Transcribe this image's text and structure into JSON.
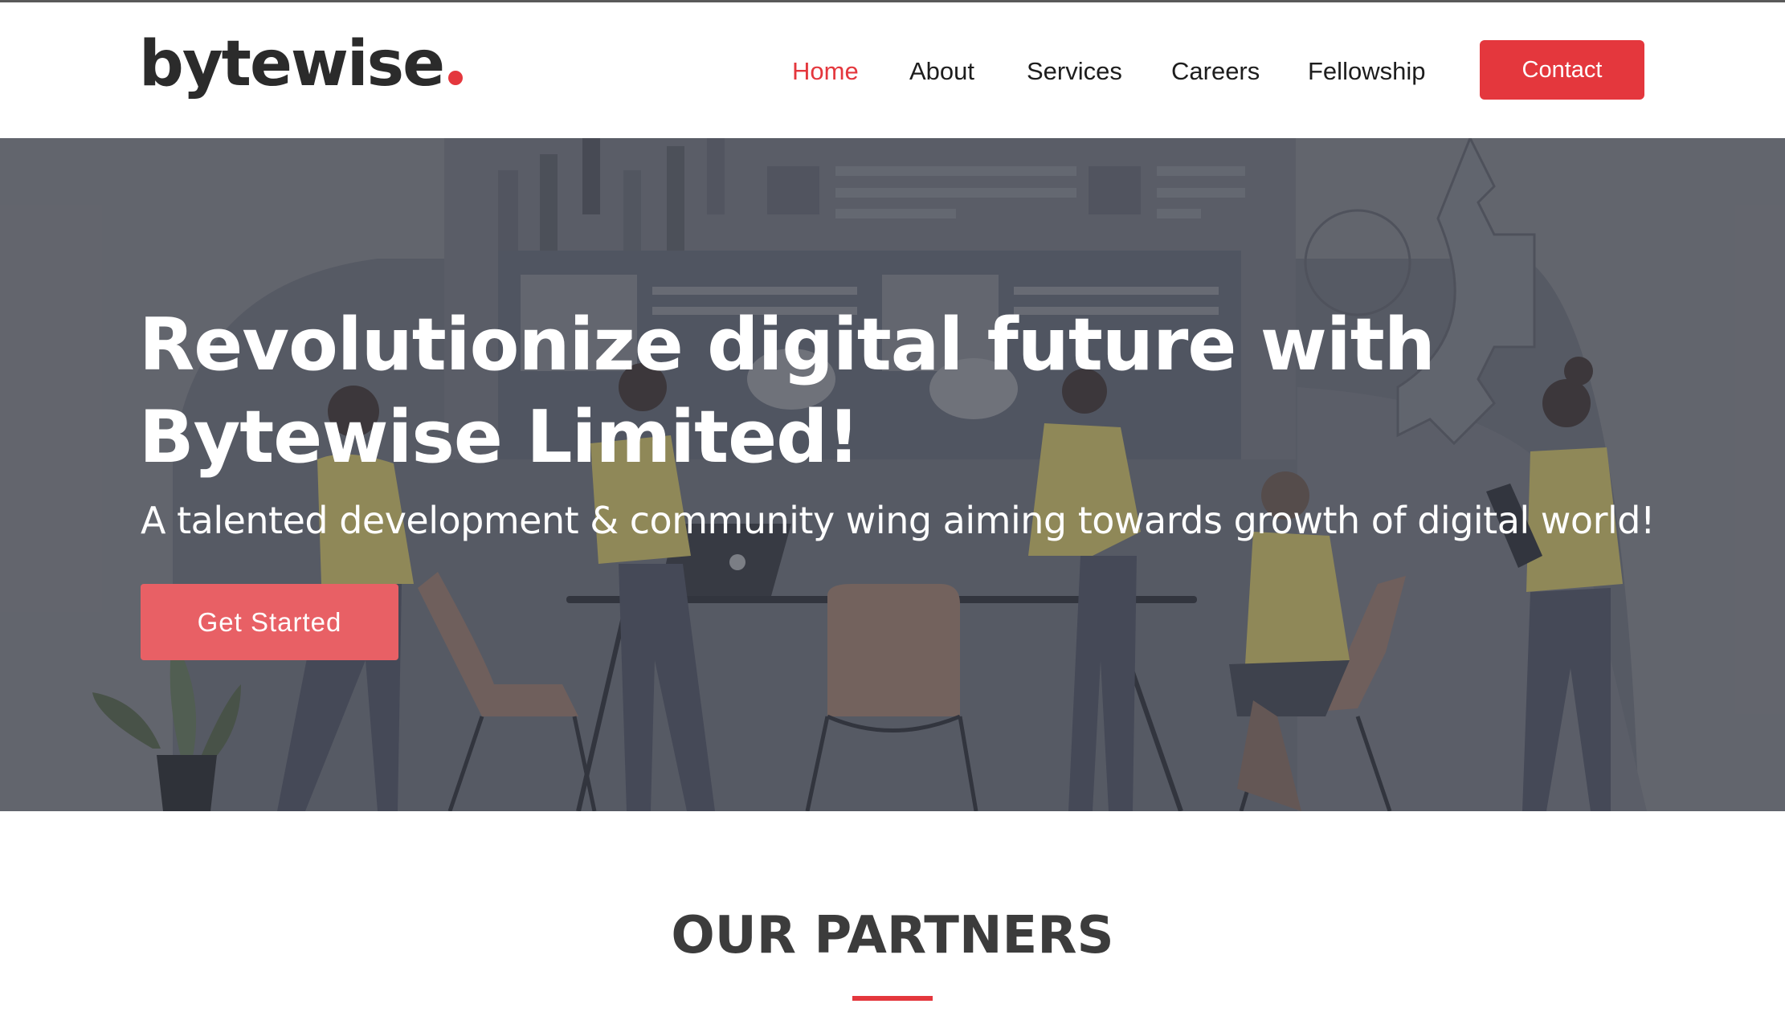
{
  "brand": {
    "name": "bytewise",
    "accent_color": "#e4373d",
    "cta_color": "#e86065",
    "text_color": "#1d1d1d"
  },
  "nav": {
    "items": [
      {
        "label": "Home",
        "active": true
      },
      {
        "label": "About",
        "active": false
      },
      {
        "label": "Services",
        "active": false
      },
      {
        "label": "Careers",
        "active": false
      },
      {
        "label": "Fellowship",
        "active": false
      }
    ],
    "contact_label": "Contact"
  },
  "hero": {
    "title_line1": "Revolutionize digital future with",
    "title_line2": "Bytewise Limited!",
    "subtitle": "A talented development & community wing aiming towards growth of digital world!",
    "cta_label": "Get Started",
    "illustration": "office-team-meeting-illustration"
  },
  "partners": {
    "title": "OUR PARTNERS"
  }
}
